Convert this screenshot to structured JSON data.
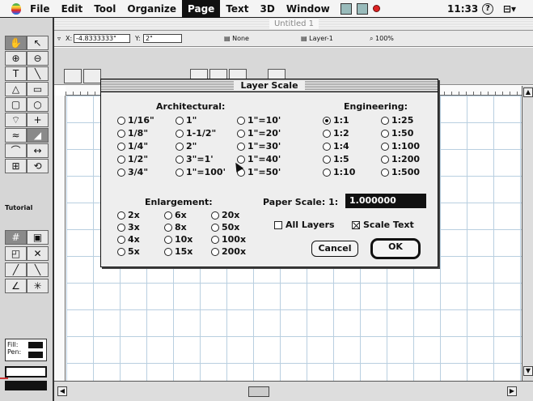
{
  "menubar": {
    "items": [
      "File",
      "Edit",
      "Tool",
      "Organize",
      "Page",
      "Text",
      "3D",
      "Window"
    ],
    "active": "Page",
    "clock": "11:33",
    "help_icon": "?"
  },
  "document": {
    "title": "Untitled 1",
    "x_label": "X:",
    "x_value": "-4.8333333\"",
    "y_label": "Y:",
    "y_value": "2\"",
    "style_value": "None",
    "layer_value": "Layer-1",
    "zoom_value": "100%"
  },
  "toolbox": {
    "tutorial_label": "Tutorial",
    "fill_label": "Fill:",
    "pen_label": "Pen:"
  },
  "dialog": {
    "title": "Layer Scale",
    "architectural_label": "Architectural:",
    "architectural_options": [
      "1/16\"",
      "1/8\"",
      "1/4\"",
      "1/2\"",
      "3/4\"",
      "1\"",
      "1-1/2\"",
      "2\"",
      "3\"=1'",
      "1\"=100'",
      "1\"=10'",
      "1\"=20'",
      "1\"=30'",
      "1\"=40'",
      "1\"=50'"
    ],
    "engineering_label": "Engineering:",
    "engineering_options": [
      "1:1",
      "1:2",
      "1:4",
      "1:5",
      "1:10",
      "1:25",
      "1:50",
      "1:100",
      "1:200",
      "1:500"
    ],
    "engineering_selected": "1:1",
    "enlargement_label": "Enlargement:",
    "enlargement_options": [
      "2x",
      "3x",
      "4x",
      "5x",
      "6x",
      "8x",
      "10x",
      "15x",
      "20x",
      "50x",
      "100x",
      "200x"
    ],
    "paper_scale_label": "Paper Scale:  1:",
    "paper_scale_value": "1.000000",
    "all_layers_label": "All Layers",
    "all_layers_checked": false,
    "scale_text_label": "Scale Text",
    "scale_text_checked": true,
    "cancel_label": "Cancel",
    "ok_label": "OK"
  }
}
